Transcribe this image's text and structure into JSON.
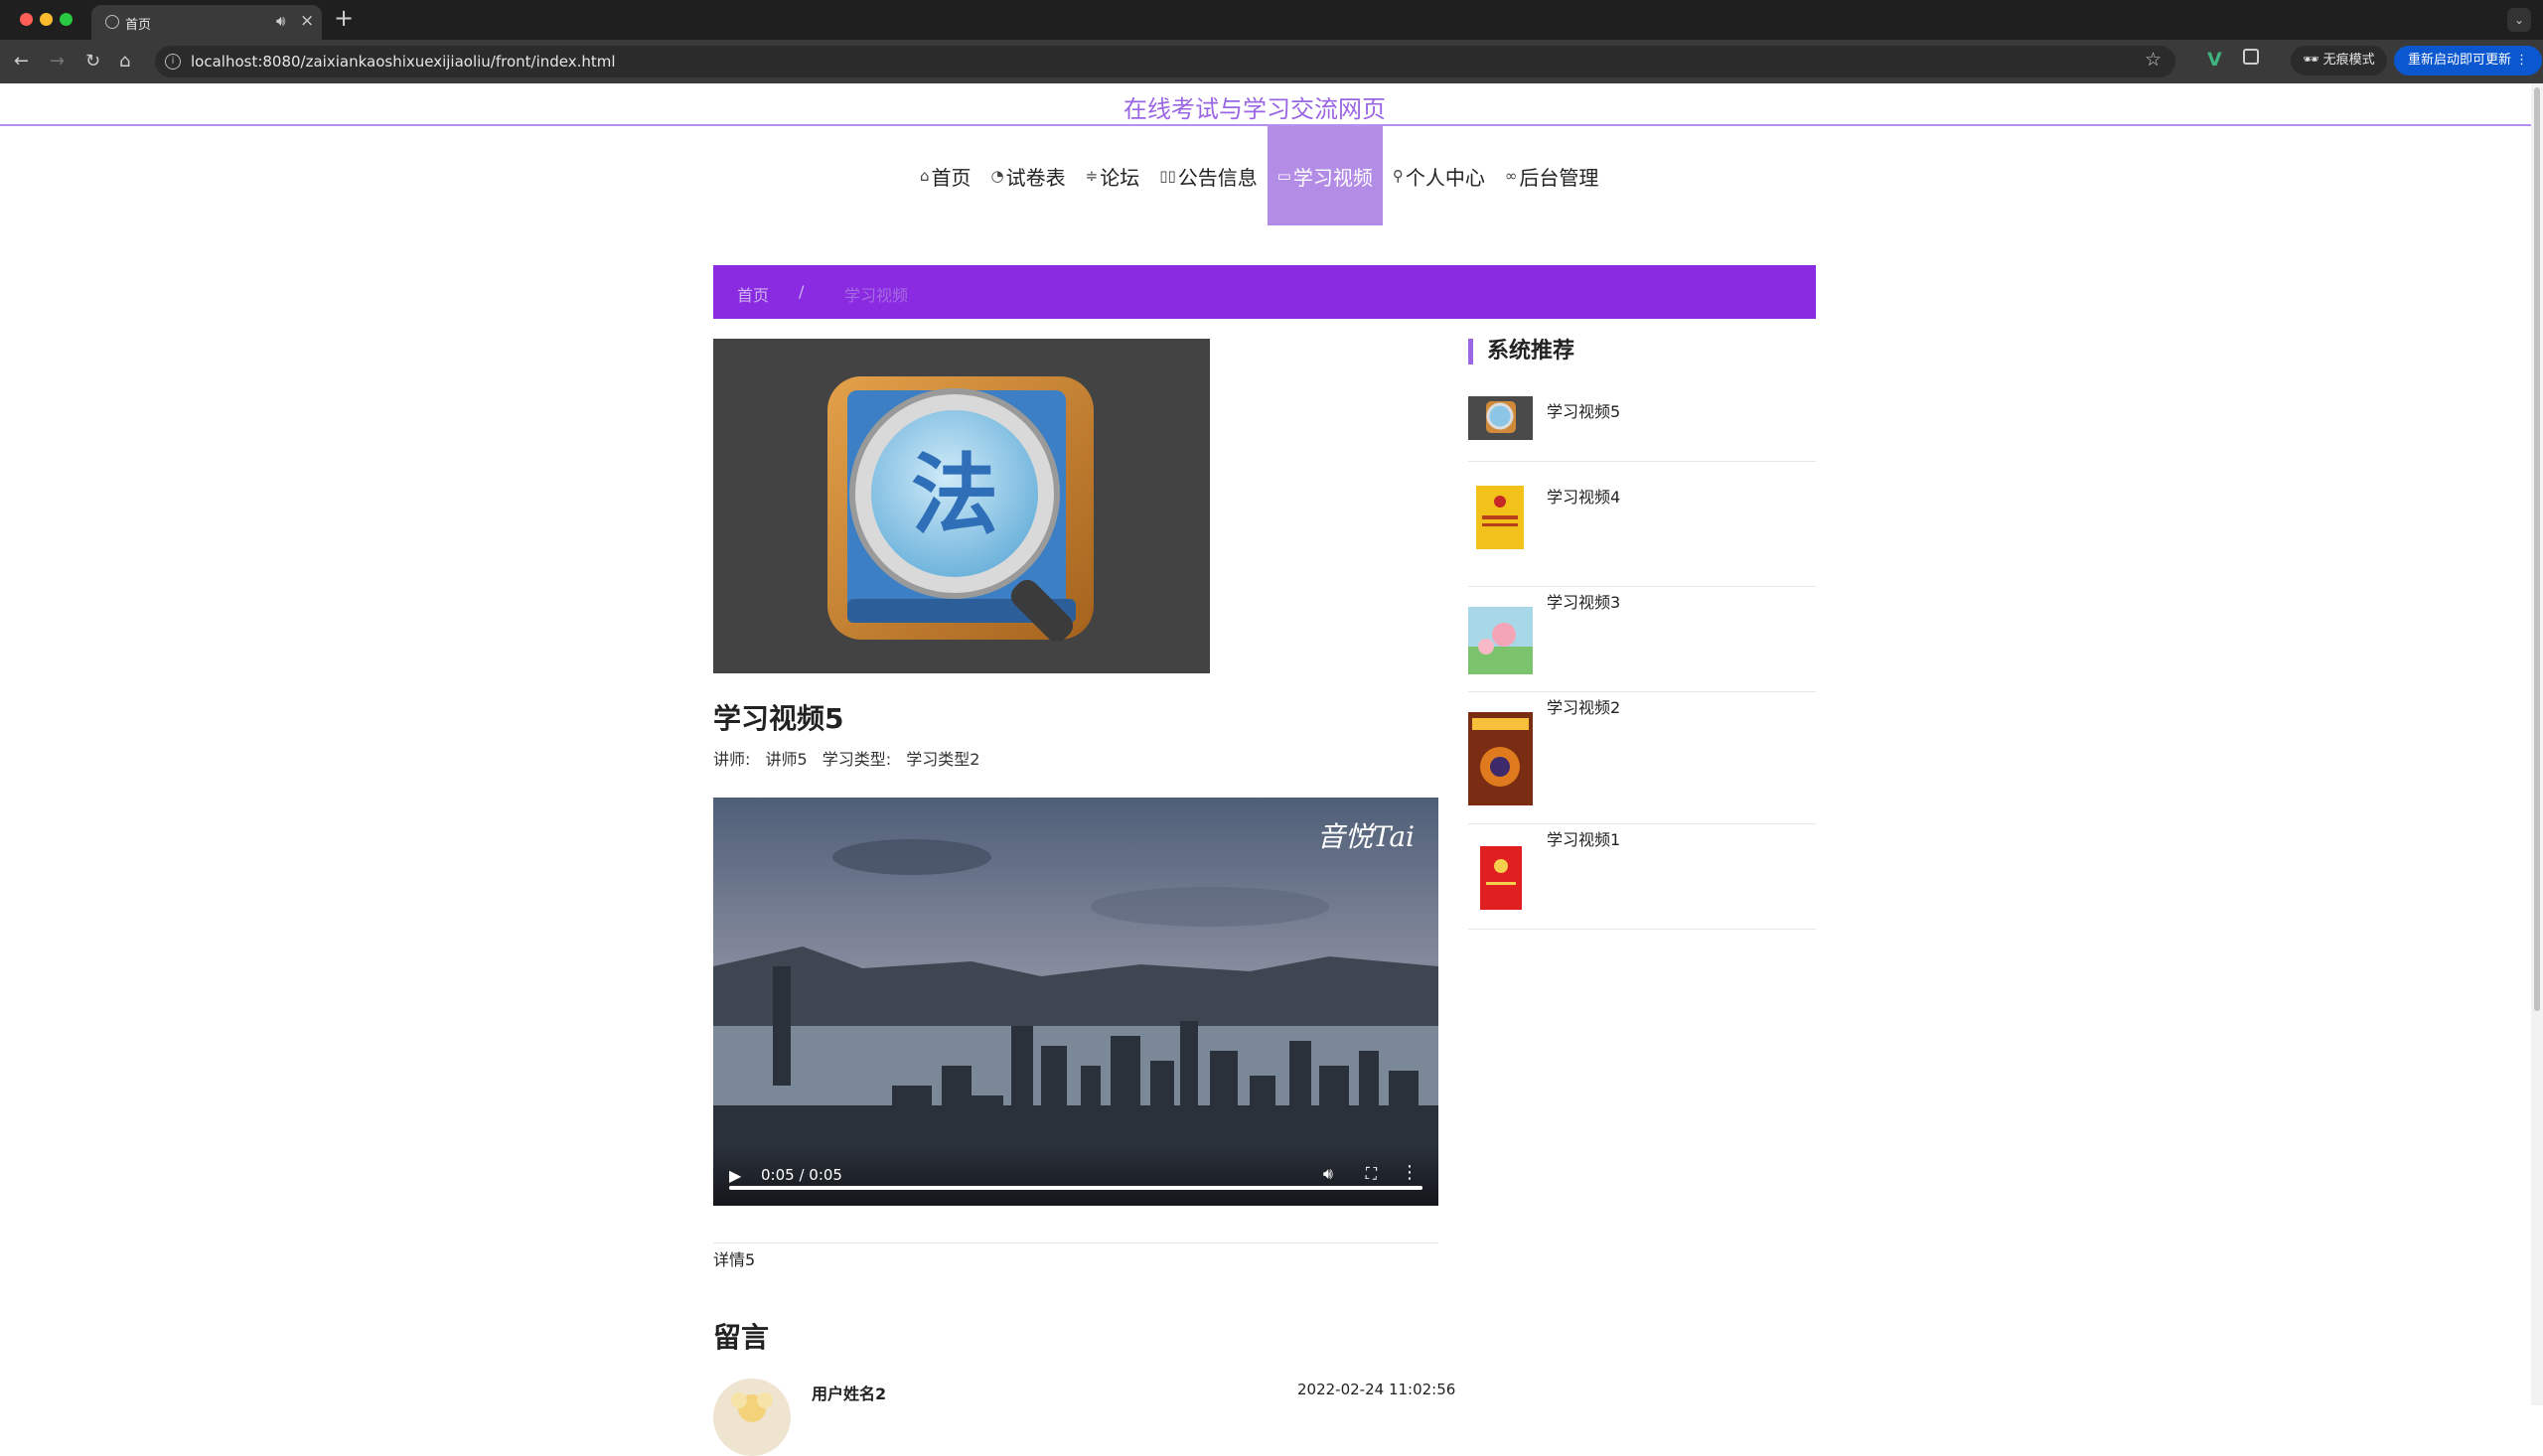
{
  "browser": {
    "tab_title": "首页",
    "url": "localhost:8080/zaixiankaoshixuexijiaoliu/front/index.html",
    "incognito_label": "无痕模式",
    "relaunch_label": "重新启动即可更新"
  },
  "site": {
    "title": "在线考试与学习交流网页"
  },
  "nav": [
    {
      "icon": "home-icon",
      "glyph": "⌂",
      "label": "首页",
      "active": false
    },
    {
      "icon": "gauge-icon",
      "glyph": "◔",
      "label": "试卷表",
      "active": false
    },
    {
      "icon": "sliders-icon",
      "glyph": "≑",
      "label": "论坛",
      "active": false
    },
    {
      "icon": "bookmarks-icon",
      "glyph": "▯▯",
      "label": "公告信息",
      "active": false
    },
    {
      "icon": "video-icon",
      "glyph": "▭",
      "label": "学习视频",
      "active": true
    },
    {
      "icon": "user-icon",
      "glyph": "⚲",
      "label": "个人中心",
      "active": false
    },
    {
      "icon": "link-icon",
      "glyph": "∞",
      "label": "后台管理",
      "active": false
    }
  ],
  "breadcrumb": {
    "home": "首页",
    "separator": "/",
    "current": "学习视频"
  },
  "video": {
    "title": "学习视频5",
    "teacher_label": "讲师:",
    "teacher": "讲师5",
    "type_label": "学习类型:",
    "type": "学习类型2",
    "watermark": "音悦Tai",
    "time": "0:05 / 0:05",
    "progress": 1.0,
    "detail": "详情5"
  },
  "comments": {
    "heading": "留言",
    "items": [
      {
        "user": "用户姓名2",
        "time": "2022-02-24 11:02:56"
      }
    ]
  },
  "recommend": {
    "title": "系统推荐",
    "items": [
      {
        "label": "学习视频5",
        "thumb": "magnifier-law-icon"
      },
      {
        "label": "学习视频4",
        "thumb": "yellow-book-cover"
      },
      {
        "label": "学习视频3",
        "thumb": "cartoon-book-cover"
      },
      {
        "label": "学习视频2",
        "thumb": "magazine-cover"
      },
      {
        "label": "学习视频1",
        "thumb": "red-book-cover"
      }
    ]
  },
  "colors": {
    "accent_purple": "#8a2be2",
    "nav_active": "#b38ce6",
    "title_purple": "#9a66e3"
  }
}
